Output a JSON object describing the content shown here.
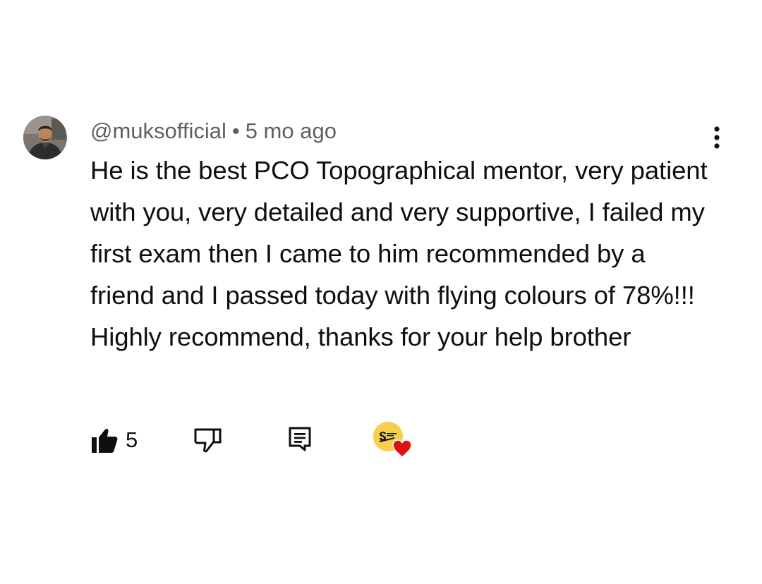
{
  "comment": {
    "author_handle": "@muksofficial",
    "separator": "•",
    "time_ago": "5 mo ago",
    "text": "He is the best PCO Topographical mentor, very patient with you, very detailed and very supportive, I failed my first exam then I came to him recommended by a friend and I passed today with flying colours of 78%!!! Highly recommend, thanks for your help brother",
    "like_count": "5"
  },
  "icons": {
    "menu": "more-vertical-icon",
    "like": "thumbs-up-filled-icon",
    "dislike": "thumbs-down-outline-icon",
    "reply": "reply-comment-icon",
    "creator_heart": "red-heart-icon"
  },
  "colors": {
    "meta_text": "#606060",
    "body_text": "#0f0f0f",
    "heart": "#e01010",
    "creator_avatar_bg": "#f7cf4a"
  }
}
